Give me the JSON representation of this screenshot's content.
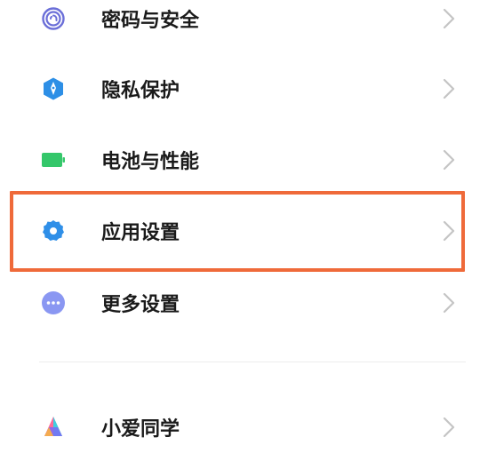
{
  "settings": {
    "items": [
      {
        "label": "密码与安全",
        "icon": "fingerprint-icon"
      },
      {
        "label": "隐私保护",
        "icon": "privacy-shield-icon"
      },
      {
        "label": "电池与性能",
        "icon": "battery-icon"
      },
      {
        "label": "应用设置",
        "icon": "gear-icon"
      },
      {
        "label": "更多设置",
        "icon": "more-dots-icon"
      }
    ],
    "assistant": {
      "label": "小爱同学",
      "icon": "xiaoai-icon"
    }
  },
  "colors": {
    "highlight_border": "#ef6a3a",
    "fingerprint": "#6b6fd8",
    "privacy": "#2d8fe6",
    "battery": "#34c76a",
    "gear": "#2f8fe8",
    "more": "#8a97f2"
  }
}
